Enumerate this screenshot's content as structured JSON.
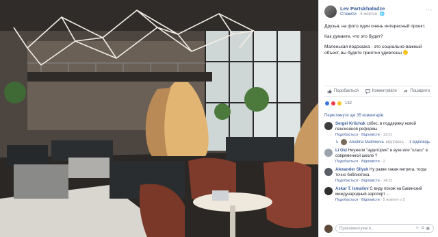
{
  "post": {
    "author": "Lev Partskhaladze",
    "follow_label": "Стежити",
    "date": "4 жовтня",
    "more_label": "···",
    "text_1": "Друзья, на фото один очень интересный проект.",
    "text_2": "Как думаете, что это будет?",
    "text_3": "Маленькая подсказка - это социально-важный объект, вы будете приятно удивлены"
  },
  "actions": {
    "like": "Подобається",
    "comment": "Коментувати",
    "share": "Поширити"
  },
  "reactions": {
    "count": "132"
  },
  "comments_header": "Переглянути ще 35 коментарів",
  "comments": [
    {
      "name": "Sergei Kriichuk",
      "text": "собес, в поддержку новой пенсионной реформы",
      "like": "Подобається",
      "reply": "Відповісти",
      "time": "13:21"
    },
    {
      "reply_name": "Alevtina Makhnova",
      "reply_label": "відповіла",
      "reply_count": "1 відповідь"
    },
    {
      "name": "Li Ost",
      "text": "Неужели \"аудитория\" в вузе или \"класс\" в современной школе ?",
      "like": "Подобається",
      "reply": "Відповісти",
      "time": "2"
    },
    {
      "name": "Alexander Silyuk",
      "text": "Ну разве такая интрига, тогда точно библиотека.",
      "like": "Подобається",
      "reply": "Відповісти",
      "time": "14:22"
    },
    {
      "name": "Askar T. Ismailov",
      "text": "С виду похож на Бакинский международный аэропорт ...",
      "like": "Подобається",
      "reply": "Відповісти",
      "time": "5 жовтня о 2"
    }
  ],
  "composer": {
    "placeholder": "Прокоментувати..."
  },
  "colors": {
    "link": "#365899",
    "muted": "#90949c",
    "text": "#1d2129",
    "like_blue": "#3b73e6",
    "love_red": "#f0394d"
  }
}
